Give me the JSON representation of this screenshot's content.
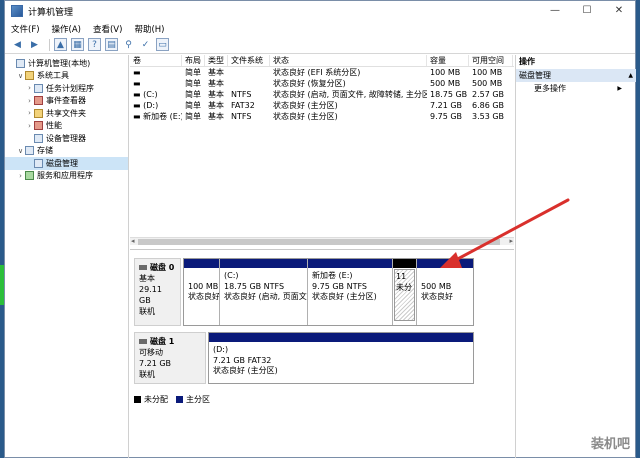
{
  "window": {
    "title": "计算机管理",
    "controls": [
      "—",
      "☐",
      "✕"
    ]
  },
  "menu": [
    "文件(F)",
    "操作(A)",
    "查看(V)",
    "帮助(H)"
  ],
  "tree": [
    {
      "label": "计算机管理(本地)",
      "indent": 0,
      "arrow": "",
      "icon": "computer"
    },
    {
      "label": "系统工具",
      "indent": 1,
      "arrow": "∨",
      "icon": "tools"
    },
    {
      "label": "任务计划程序",
      "indent": 2,
      "arrow": "›",
      "icon": "clock"
    },
    {
      "label": "事件查看器",
      "indent": 2,
      "arrow": "›",
      "icon": "event"
    },
    {
      "label": "共享文件夹",
      "indent": 2,
      "arrow": "›",
      "icon": "folder"
    },
    {
      "label": "性能",
      "indent": 2,
      "arrow": "›",
      "icon": "perf"
    },
    {
      "label": "设备管理器",
      "indent": 2,
      "arrow": "",
      "icon": "device"
    },
    {
      "label": "存储",
      "indent": 1,
      "arrow": "∨",
      "icon": "storage"
    },
    {
      "label": "磁盘管理",
      "indent": 2,
      "arrow": "",
      "icon": "disk",
      "selected": true
    },
    {
      "label": "服务和应用程序",
      "indent": 1,
      "arrow": "›",
      "icon": "services"
    }
  ],
  "volumes": {
    "headers": [
      "卷",
      "布局",
      "类型",
      "文件系统",
      "状态",
      "容量",
      "可用空间"
    ],
    "rows": [
      [
        "▬",
        "简单",
        "基本",
        "",
        "状态良好 (EFI 系统分区)",
        "100 MB",
        "100 MB"
      ],
      [
        "▬",
        "简单",
        "基本",
        "",
        "状态良好 (恢复分区)",
        "500 MB",
        "500 MB"
      ],
      [
        "▬ (C:)",
        "简单",
        "基本",
        "NTFS",
        "状态良好 (启动, 页面文件, 故障转储, 主分区)",
        "18.75 GB",
        "2.57 GB"
      ],
      [
        "▬ (D:)",
        "简单",
        "基本",
        "FAT32",
        "状态良好 (主分区)",
        "7.21 GB",
        "6.86 GB"
      ],
      [
        "▬ 新加卷 (E:)",
        "简单",
        "基本",
        "NTFS",
        "状态良好 (主分区)",
        "9.75 GB",
        "3.53 GB"
      ]
    ]
  },
  "disks": [
    {
      "name": "磁盘 0",
      "type": "基本",
      "size": "29.11 GB",
      "status": "联机",
      "partitions": [
        {
          "lines": [
            "",
            "100 MB",
            "状态良好"
          ],
          "bar": "primary"
        },
        {
          "lines": [
            "(C:)",
            "18.75 GB NTFS",
            "状态良好 (启动, 页面文件"
          ],
          "bar": "primary"
        },
        {
          "lines": [
            "新加卷  (E:)",
            "9.75 GB NTFS",
            "状态良好 (主分区)"
          ],
          "bar": "primary"
        },
        {
          "lines": [
            "11",
            "未分"
          ],
          "bar": "unallocated",
          "hatch": true
        },
        {
          "lines": [
            "",
            "500 MB",
            "状态良好"
          ],
          "bar": "primary"
        }
      ]
    },
    {
      "name": "磁盘 1",
      "type": "可移动",
      "size": "7.21 GB",
      "status": "联机",
      "partitions": [
        {
          "lines": [
            "(D:)",
            "7.21 GB FAT32",
            "状态良好 (主分区)"
          ],
          "bar": "primary"
        }
      ]
    }
  ],
  "legend": [
    {
      "label": "未分配",
      "color": "#000000"
    },
    {
      "label": "主分区",
      "color": "#0a1a7a"
    }
  ],
  "actions": {
    "header": "操作",
    "section": "磁盘管理",
    "section_arrow": "▲",
    "item": "更多操作",
    "item_arrow": "▶"
  },
  "watermark": "装机吧",
  "colors": {
    "accent_arrow": "#d9302c",
    "primary_partition": "#0a1a7a",
    "selection": "#cce4f7"
  }
}
